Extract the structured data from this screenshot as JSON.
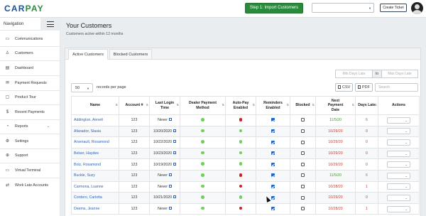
{
  "topbar": {
    "logo": "CARPAY",
    "step_button": "Step 1: Import Customers",
    "create_ticket": "Create Ticket"
  },
  "colors": {
    "brand_blue": "#1b4f9b",
    "brand_green": "#2a8a3c",
    "link_blue": "#2d66b3",
    "late_red": "#d13b2e",
    "paid_green": "#3e9e2f",
    "status_on": "#6fd05a",
    "status_off": "#d11f1f"
  },
  "sidebar": {
    "title": "Navigation",
    "items": [
      {
        "label": "Communications",
        "icon": "communications-icon"
      },
      {
        "label": "Customers",
        "icon": "customers-icon",
        "active": true
      },
      {
        "label": "Dashboard",
        "icon": "dashboard-icon"
      },
      {
        "label": "Payment Requests",
        "icon": "payment-requests-icon"
      },
      {
        "label": "Product Tour",
        "icon": "product-tour-icon"
      },
      {
        "label": "Recent Payments",
        "icon": "dollar-icon"
      },
      {
        "label": "Reports",
        "icon": "reports-icon",
        "has_submenu": true
      },
      {
        "label": "Settings",
        "icon": "gear-icon"
      },
      {
        "label": "Support",
        "icon": "support-icon"
      },
      {
        "label": "Virtual Terminal",
        "icon": "virtual-terminal-icon"
      },
      {
        "label": "Work Late Accounts",
        "icon": "work-late-accounts-icon"
      }
    ]
  },
  "main": {
    "title": "Your Customers",
    "subtitle": "Customers active within 12 months",
    "tabs": [
      {
        "label": "Active Customers",
        "active": true
      },
      {
        "label": "Blocked Customers",
        "active": false
      }
    ],
    "filter": {
      "min_placeholder": "Min Days Late",
      "to_label": "to",
      "max_placeholder": "Max Days Late"
    },
    "records_per_page": "50",
    "records_label": "records per page",
    "csv_label": "CSV",
    "pdf_label": "PDF",
    "search_placeholder": "Search"
  },
  "table": {
    "columns": [
      "Name",
      "Account #",
      "Last Login Time",
      "Dealer Payment Method",
      "Auto-Pay Enabled",
      "Reminders Enabled",
      "Blocked",
      "Next Payment Date",
      "Days Late",
      "Actions"
    ],
    "rows": [
      {
        "name": "Addington, Annett",
        "account": "123",
        "last_login": "Never",
        "dealer_payment": "on",
        "autopay": "off",
        "reminders": true,
        "blocked": false,
        "next_payment": "11/5/20",
        "days_late": "6",
        "status": "green"
      },
      {
        "name": "Afanador, Stasia",
        "account": "123",
        "last_login": "10/20/2020",
        "dealer_payment": "on",
        "autopay": "on",
        "reminders": true,
        "blocked": false,
        "next_payment": "10/29/20",
        "days_late": "0",
        "status": "red"
      },
      {
        "name": "Arsenault, Rosamond",
        "account": "123",
        "last_login": "10/22/2020",
        "dealer_payment": "on",
        "autopay": "on",
        "reminders": true,
        "blocked": false,
        "next_payment": "10/29/20",
        "days_late": "0",
        "status": "red"
      },
      {
        "name": "Belser, Haydee",
        "account": "123",
        "last_login": "10/23/2020",
        "dealer_payment": "on",
        "autopay": "on",
        "reminders": true,
        "blocked": false,
        "next_payment": "10/29/20",
        "days_late": "0",
        "status": "red"
      },
      {
        "name": "Bolz, Rosamond",
        "account": "123",
        "last_login": "10/19/2020",
        "dealer_payment": "on",
        "autopay": "on",
        "reminders": true,
        "blocked": false,
        "next_payment": "10/29/20",
        "days_late": "0",
        "status": "red"
      },
      {
        "name": "Buckle, Suzy",
        "account": "123",
        "last_login": "Never",
        "dealer_payment": "on",
        "autopay": "off",
        "reminders": true,
        "blocked": false,
        "next_payment": "11/5/20",
        "days_late": "6",
        "status": "green"
      },
      {
        "name": "Carmona, Luanne",
        "account": "123",
        "last_login": "Never",
        "dealer_payment": "on",
        "autopay": "off",
        "reminders": true,
        "blocked": false,
        "next_payment": "10/28/20",
        "days_late": "1",
        "status": "red"
      },
      {
        "name": "Cordero, Carlotta",
        "account": "123",
        "last_login": "10/21/2020",
        "dealer_payment": "on",
        "autopay": "on",
        "reminders": true,
        "blocked": false,
        "next_payment": "10/29/20",
        "days_late": "0",
        "status": "red"
      },
      {
        "name": "Deems, Jeanne",
        "account": "123",
        "last_login": "Never",
        "dealer_payment": "on",
        "autopay": "off",
        "reminders": true,
        "blocked": false,
        "next_payment": "10/28/20",
        "days_late": "1",
        "status": "red"
      }
    ]
  }
}
